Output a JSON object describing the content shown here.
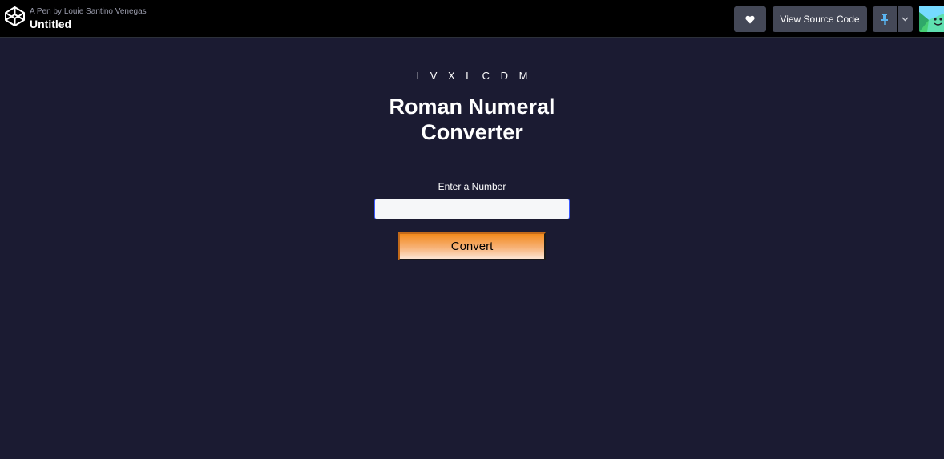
{
  "header": {
    "pen_by_prefix": "A Pen by",
    "author": "Louie Santino Venegas",
    "title": "Untitled",
    "heart_icon": "heart-icon",
    "view_source_label": "View Source Code",
    "pin_icon": "pin-icon",
    "chevron_icon": "chevron-down-icon"
  },
  "main": {
    "roman_letters": "I V X L C D M",
    "title_line1": "Roman Numeral",
    "title_line2": "Converter",
    "input_label": "Enter a Number",
    "input_value": "",
    "input_placeholder": "",
    "convert_label": "Convert"
  },
  "colors": {
    "background": "#1b1b32",
    "topbar": "#000000",
    "header_button": "#444857",
    "convert_gradient_top": "#f28a1c",
    "convert_gradient_bottom": "#fde6d4",
    "input_border": "#3b59ff"
  }
}
